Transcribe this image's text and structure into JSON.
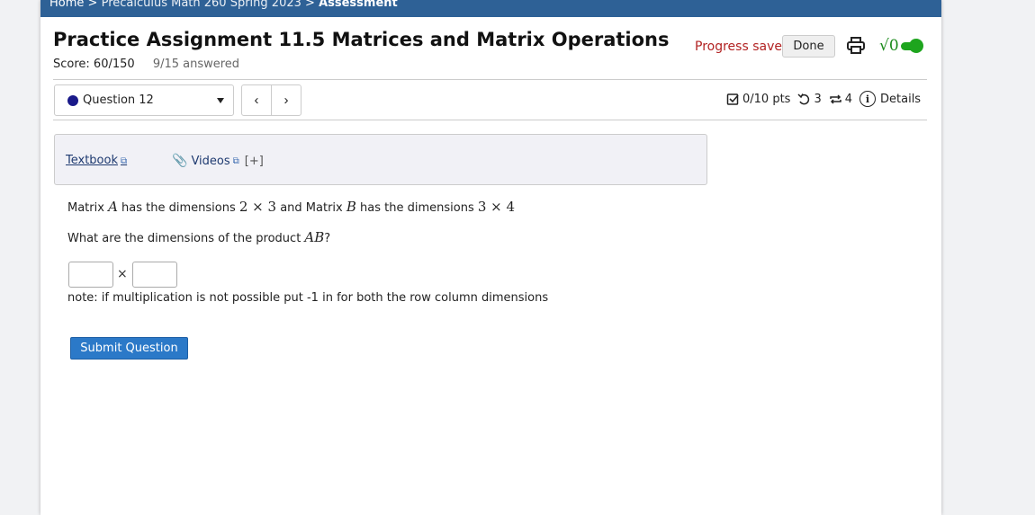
{
  "breadcrumb": {
    "home": "Home",
    "sep1": ">",
    "course": "Precalculus Math 260 Spring 2023",
    "sep2": ">",
    "current": "Assessment"
  },
  "header": {
    "title": "Practice Assignment 11.5 Matrices and Matrix Operations",
    "score": "Score: 60/150",
    "answered": "9/15 answered",
    "progress_saved": "Progress saved",
    "done_label": "Done",
    "math_toggle_symbol": "√0"
  },
  "question_nav": {
    "selected": "Question 12",
    "prev_symbol": "‹",
    "next_symbol": "›"
  },
  "meta": {
    "points": "0/10 pts",
    "retries": "3",
    "attempts": "4",
    "details": "Details"
  },
  "help": {
    "textbook": "Textbook",
    "videos": "Videos",
    "more": "[+]"
  },
  "question": {
    "line1_a": "Matrix ",
    "var_a": "A",
    "line1_b": " has the dimensions ",
    "dims_a": "2 × 3",
    "line1_c": " and Matrix ",
    "var_b": "B",
    "line1_d": " has the dimensions ",
    "dims_b": "3 × 4",
    "line2_a": "What are the dimensions of the product ",
    "product": "AB",
    "line2_b": "?",
    "times_symbol": "×",
    "note": "note: if multiplication is not possible put -1 in for both the row column dimensions",
    "answer_rows": "",
    "answer_cols": ""
  },
  "submit_label": "Submit Question"
}
